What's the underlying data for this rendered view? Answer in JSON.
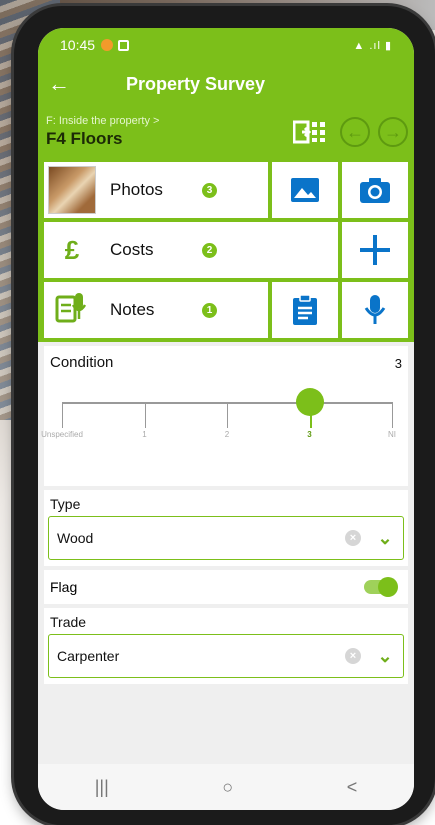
{
  "status": {
    "time": "10:45"
  },
  "appbar": {
    "title": "Property Survey",
    "back": "←"
  },
  "section": {
    "breadcrumb": "F: Inside the property  >",
    "title": "F4 Floors"
  },
  "rows": [
    {
      "label": "Photos",
      "badge": "3"
    },
    {
      "label": "Costs",
      "badge": "2"
    },
    {
      "label": "Notes",
      "badge": "1"
    }
  ],
  "condition": {
    "label": "Condition",
    "value": "3",
    "ticks": [
      "Unspecified",
      "1",
      "2",
      "3",
      "NI"
    ],
    "selected_index": 3
  },
  "type": {
    "label": "Type",
    "value": "Wood"
  },
  "flag": {
    "label": "Flag",
    "on": true
  },
  "trade": {
    "label": "Trade",
    "value": "Carpenter"
  },
  "nav": {
    "recents": "|||",
    "home": "○",
    "back": "<"
  },
  "colors": {
    "accent": "#7cbf1a",
    "blue": "#0a74c9"
  }
}
